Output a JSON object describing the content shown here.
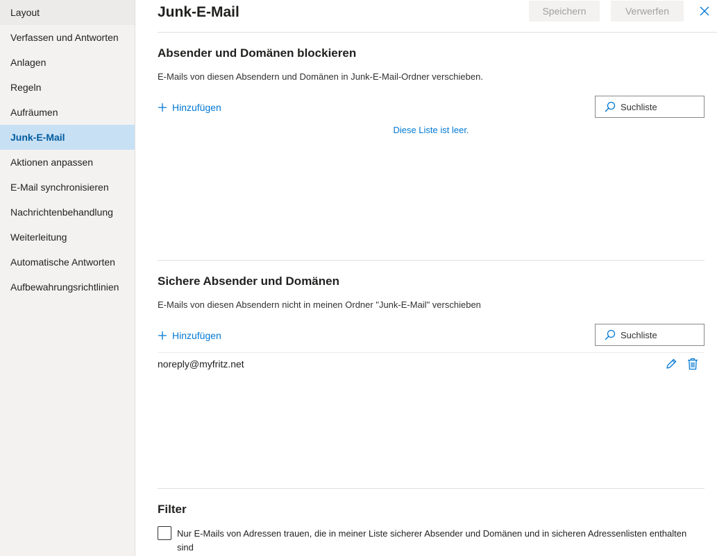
{
  "sidebar": {
    "items": [
      {
        "label": "Layout"
      },
      {
        "label": "Verfassen und Antworten"
      },
      {
        "label": "Anlagen"
      },
      {
        "label": "Regeln"
      },
      {
        "label": "Aufräumen"
      },
      {
        "label": "Junk-E-Mail"
      },
      {
        "label": "Aktionen anpassen"
      },
      {
        "label": "E-Mail synchronisieren"
      },
      {
        "label": "Nachrichtenbehandlung"
      },
      {
        "label": "Weiterleitung"
      },
      {
        "label": "Automatische Antworten"
      },
      {
        "label": "Aufbewahrungsrichtlinien"
      }
    ],
    "active": "Junk-E-Mail"
  },
  "header": {
    "title": "Junk-E-Mail",
    "save_label": "Speichern",
    "discard_label": "Verwerfen",
    "close_icon": "close-icon"
  },
  "blocked": {
    "title": "Absender und Domänen blockieren",
    "description": "E-Mails von diesen Absendern und Domänen in Junk-E-Mail-Ordner verschieben.",
    "add_label": "Hinzufügen",
    "search_placeholder": "Suchliste",
    "empty_message": "Diese Liste ist leer."
  },
  "safe": {
    "title": "Sichere Absender und Domänen",
    "description": "E-Mails von diesen Absendern nicht in meinen Ordner \"Junk-E-Mail\" verschieben",
    "add_label": "Hinzufügen",
    "search_placeholder": "Suchliste",
    "entries": [
      {
        "address": "noreply@myfritz.net"
      }
    ]
  },
  "filter": {
    "title": "Filter",
    "checkbox_label": "Nur E-Mails von Adressen trauen, die in meiner Liste sicherer Absender und Domänen und in sicheren Adressenlisten enthalten sind",
    "checked": false
  },
  "colors": {
    "accent": "#0078d4",
    "active_nav_bg": "#c7e0f4",
    "sidebar_bg": "#f3f2f1"
  }
}
